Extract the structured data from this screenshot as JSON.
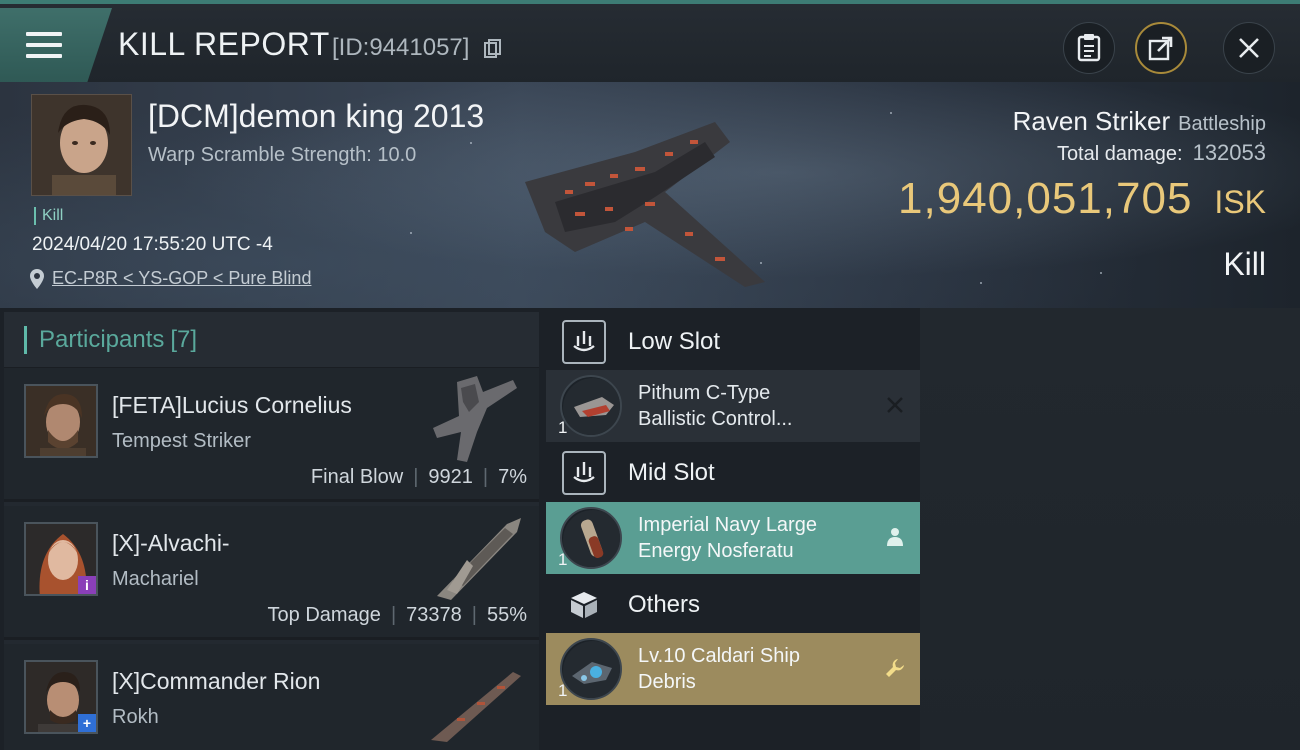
{
  "header": {
    "title": "KILL REPORT",
    "report_id": "[ID:9441057]",
    "icons": [
      "menu-icon",
      "copy-icon",
      "clipboard-icon",
      "share-icon",
      "close-icon"
    ]
  },
  "victim": {
    "name": "[DCM]demon king 2013",
    "subtitle": "Warp Scramble Strength: 10.0",
    "tag": "Kill",
    "datetime": "2024/04/20 17:55:20 UTC -4",
    "location": "EC-P8R < YS-GOP < Pure Blind",
    "ship_name": "Raven Striker",
    "ship_class": "Battleship",
    "total_damage_label": "Total damage:",
    "total_damage": "132053",
    "isk_value": "1,940,051,705",
    "isk_unit": "ISK",
    "result": "Kill"
  },
  "participants": {
    "label": "Participants",
    "count": "[7]",
    "rows": [
      {
        "name": "[FETA]Lucius Cornelius",
        "ship": "Tempest Striker",
        "stat_label": "Final Blow",
        "damage": "9921",
        "percent": "7%"
      },
      {
        "name": "[X]-Alvachi-",
        "ship": "Machariel",
        "stat_label": "Top Damage",
        "damage": "73378",
        "percent": "55%"
      },
      {
        "name": "[X]Commander Rion",
        "ship": "Rokh"
      }
    ]
  },
  "slots": {
    "low": {
      "title": "Low Slot",
      "modules": [
        {
          "qty": "1",
          "name_line1": "Pithum C-Type",
          "name_line2": "Ballistic Control..."
        }
      ]
    },
    "mid": {
      "title": "Mid Slot",
      "modules": [
        {
          "qty": "1",
          "name_line1": "Imperial Navy Large",
          "name_line2": "Energy Nosferatu"
        }
      ]
    },
    "others": {
      "title": "Others",
      "modules": [
        {
          "qty": "1",
          "name_line1": "Lv.10 Caldari Ship",
          "name_line2": "Debris"
        }
      ]
    }
  },
  "colors": {
    "accent_teal": "#5a9e93",
    "accent_gold": "#e9c87a",
    "faction_gold": "#9c8b5e"
  }
}
